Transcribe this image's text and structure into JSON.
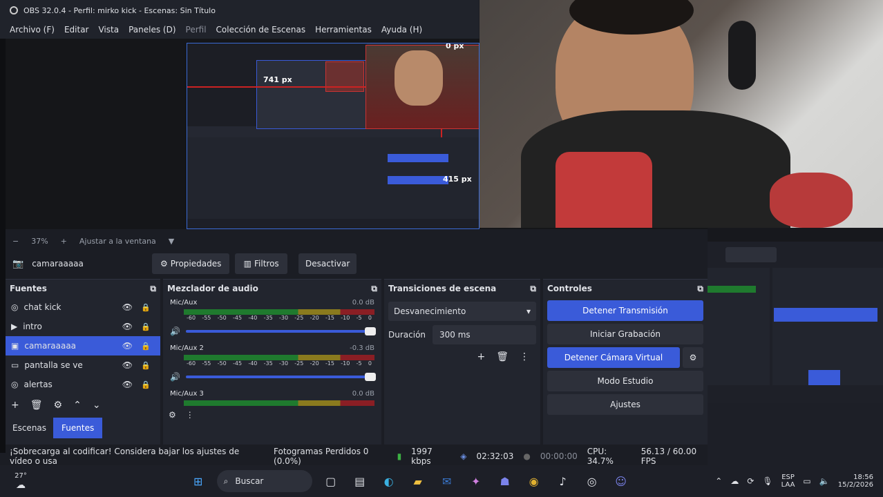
{
  "window": {
    "title": "OBS 32.0.4 - Perfil: mirko kick - Escenas: Sin Título"
  },
  "menu": [
    "Archivo (F)",
    "Editar",
    "Vista",
    "Paneles (D)",
    "Perfil",
    "Colección de Escenas",
    "Herramientas",
    "Ayuda (H)"
  ],
  "preview": {
    "mini_labels": {
      "top": "0 px",
      "left": "741 px",
      "right": "415 px"
    }
  },
  "zoom": {
    "minus": "−",
    "percent": "37%",
    "plus": "+",
    "fit": "Ajustar a la ventana"
  },
  "source_bar": {
    "selected": "camaraaaaa",
    "props": "Propiedades",
    "filters": "Filtros",
    "deactivate": "Desactivar"
  },
  "sources": {
    "title": "Fuentes",
    "items": [
      {
        "label": "chat kick",
        "icon": "globe-icon"
      },
      {
        "label": "intro",
        "icon": "play-icon"
      },
      {
        "label": "camaraaaaa",
        "icon": "camera-icon",
        "selected": true
      },
      {
        "label": "pantalla se ve",
        "icon": "monitor-icon"
      },
      {
        "label": "alertas",
        "icon": "globe-icon"
      }
    ],
    "tabs": [
      "Escenas",
      "Fuentes"
    ]
  },
  "mixer": {
    "title": "Mezclador de audio",
    "channels": [
      {
        "name": "Mic/Aux",
        "db": "0.0 dB"
      },
      {
        "name": "Mic/Aux 2",
        "db": "-0.3 dB"
      },
      {
        "name": "Mic/Aux 3",
        "db": "0.0 dB"
      }
    ],
    "ticks": [
      "-60",
      "-55",
      "-50",
      "-45",
      "-40",
      "-35",
      "-30",
      "-25",
      "-20",
      "-15",
      "-10",
      "-5",
      "0"
    ]
  },
  "transitions": {
    "title": "Transiciones de escena",
    "selected": "Desvanecimiento",
    "duration_label": "Duración",
    "duration": "300 ms"
  },
  "controls": {
    "title": "Controles",
    "stop_stream": "Detener Transmisión",
    "start_record": "Iniciar Grabación",
    "stop_vcam": "Detener Cámara Virtual",
    "studio": "Modo Estudio",
    "settings": "Ajustes"
  },
  "status": {
    "warning": "¡Sobrecarga al codificar! Considera bajar los ajustes de vídeo o usa",
    "dropped": "Fotogramas Perdidos 0 (0.0%)",
    "bitrate": "1997 kbps",
    "stream_time": "02:32:03",
    "rec_time": "00:00:00",
    "cpu": "CPU: 34.7%",
    "fps": "56.13 / 60.00 FPS"
  },
  "taskbar": {
    "weather": "27°",
    "search": "Buscar",
    "lang1": "ESP",
    "lang2": "LAA",
    "time": "18:56",
    "date": "15/2/2026"
  },
  "colors": {
    "accent": "#3a5bd9",
    "bg": "#1b1d24",
    "dock": "#22252e"
  }
}
